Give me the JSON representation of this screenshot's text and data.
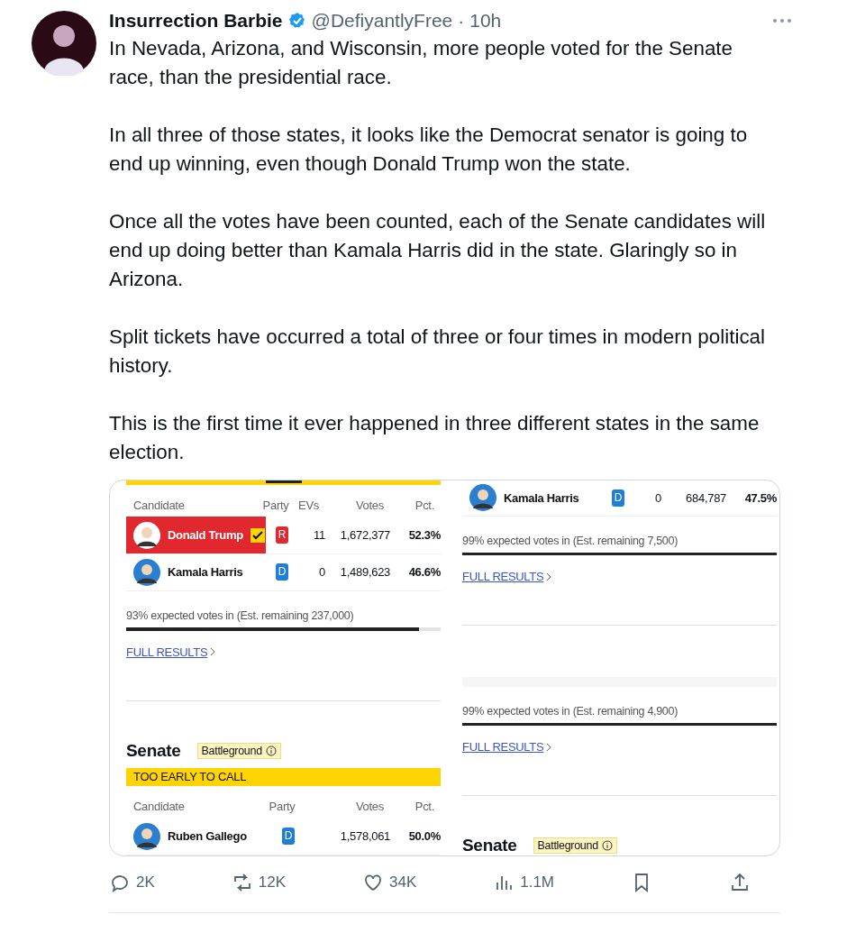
{
  "tweet": {
    "author": {
      "name": "Insurrection Barbie",
      "verified": true,
      "handle": "@DefiyantlyFree",
      "separator": "·",
      "time": "10h"
    },
    "paragraphs": [
      "In Nevada, Arizona, and Wisconsin, more people voted for the Senate race, than the presidential race.",
      "In all three of those states, it looks like the Democrat senator is going to end up winning, even though Donald Trump won the state.",
      "Once all the votes have been counted, each of the Senate candidates will end up doing better than Kamala Harris did in the state. Glaringly so in Arizona.",
      "Split tickets have occurred a total of three or four times in modern political history.",
      "This is the first time it ever happened in three different states in the same election."
    ],
    "media": {
      "panels": [
        {
          "blocks": [
            {
              "kind": "topbar"
            },
            {
              "kind": "table",
              "columns": [
                "Candidate",
                "Party",
                "EVs",
                "Votes",
                "Pct."
              ],
              "rows": [
                {
                  "name": "Donald Trump",
                  "winner": true,
                  "party": "R",
                  "color": "#e0282e",
                  "evs": "11",
                  "votes": "1,672,377",
                  "pct": "52.3%"
                },
                {
                  "name": "Kamala Harris",
                  "winner": false,
                  "party": "D",
                  "color": "#1f7fd8",
                  "evs": "0",
                  "votes": "1,489,623",
                  "pct": "46.6%"
                }
              ]
            },
            {
              "kind": "progress",
              "text": "93% expected votes in (Est. remaining 237,000)",
              "level": 0.93
            },
            {
              "kind": "link",
              "text": "FULL RESULTS"
            },
            {
              "kind": "divider"
            },
            {
              "kind": "heading",
              "title": "Senate",
              "badge": "Battleground"
            },
            {
              "kind": "banner",
              "text": "TOO EARLY TO CALL"
            },
            {
              "kind": "table",
              "columns": [
                "Candidate",
                "Party",
                "Votes",
                "Pct."
              ],
              "rows": [
                {
                  "name": "Ruben Gallego",
                  "winner": false,
                  "party": "D",
                  "color": "#1f7fd8",
                  "votes": "1,578,061",
                  "pct": "50.0%"
                }
              ]
            }
          ]
        },
        {
          "blocks": [
            {
              "kind": "table",
              "rows": [
                {
                  "name": "Kamala Harris",
                  "winner": false,
                  "party": "D",
                  "color": "#1f7fd8",
                  "evs": "0",
                  "votes": "684,787",
                  "pct": "47.5%"
                }
              ]
            },
            {
              "kind": "progress",
              "text": "99% expected votes in (Est. remaining 7,500)",
              "level": 1
            },
            {
              "kind": "link",
              "text": "FULL RESULTS"
            },
            {
              "kind": "divider"
            },
            {
              "kind": "glitch"
            },
            {
              "kind": "progress",
              "text": "99% expected votes in (Est. remaining 4,900)",
              "level": 1
            },
            {
              "kind": "link",
              "text": "FULL RESULTS"
            },
            {
              "kind": "divider"
            },
            {
              "kind": "heading",
              "title": "Senate",
              "badge": "Battleground"
            }
          ]
        }
      ]
    },
    "actions": [
      {
        "kind": "reply",
        "count": "2K"
      },
      {
        "kind": "repost",
        "count": "12K"
      },
      {
        "kind": "like",
        "count": "34K"
      },
      {
        "kind": "views",
        "count": "1.1M"
      },
      {
        "kind": "bookmark"
      },
      {
        "kind": "share"
      }
    ]
  }
}
